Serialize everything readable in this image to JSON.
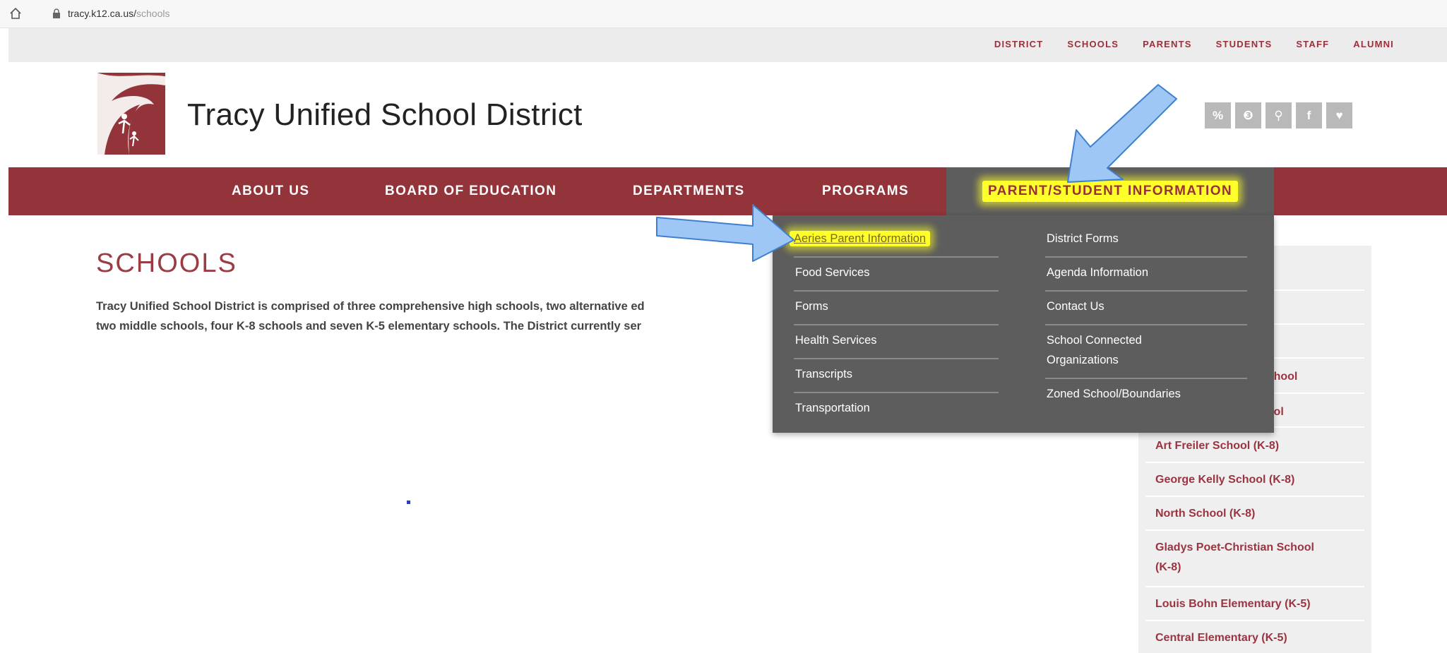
{
  "browser": {
    "url_host": "tracy.k12.ca.us/",
    "url_path": "schools"
  },
  "utility_nav": [
    "DISTRICT",
    "SCHOOLS",
    "PARENTS",
    "STUDENTS",
    "STAFF",
    "ALUMNI"
  ],
  "header": {
    "title": "Tracy Unified School District"
  },
  "social_icons": [
    "link-icon",
    "globe-icon",
    "search-icon",
    "facebook-icon",
    "twitter-icon"
  ],
  "social_glyphs": [
    "%",
    "❸",
    "⚲",
    "f",
    "♥"
  ],
  "main_nav": [
    "ABOUT US",
    "BOARD OF EDUCATION",
    "DEPARTMENTS",
    "PROGRAMS",
    "PARENT/STUDENT INFORMATION"
  ],
  "dropdown": {
    "left": [
      "Aeries Parent Information",
      "Food Services",
      "Forms",
      "Health Services",
      "Transcripts",
      "Transportation"
    ],
    "right": [
      "District Forms",
      "Agenda Information",
      "Contact Us",
      "School Connected",
      "Organizations",
      "Zoned School/Boundaries"
    ]
  },
  "page": {
    "title": "SCHOOLS",
    "intro_line1": "Tracy Unified School District is comprised of three comprehensive high schools, two alternative ed",
    "intro_line2": "two middle schools, four K-8 schools and seven K-5 elementary schools.  The District  currently ser"
  },
  "sidebar": {
    "partial": [
      "l",
      "School",
      "hool"
    ],
    "items": [
      "Art Freiler School (K-8)",
      "George Kelly School (K-8)",
      "North School (K-8)",
      "Gladys Poet-Christian School",
      "(K-8)",
      "Louis Bohn Elementary (K-5)",
      "Central Elementary (K-5)"
    ]
  },
  "colors": {
    "brand": "#923439",
    "dropdown_bg": "#5d5d5d",
    "highlight": "#ffff2a",
    "arrow": "#9ec7f5"
  }
}
